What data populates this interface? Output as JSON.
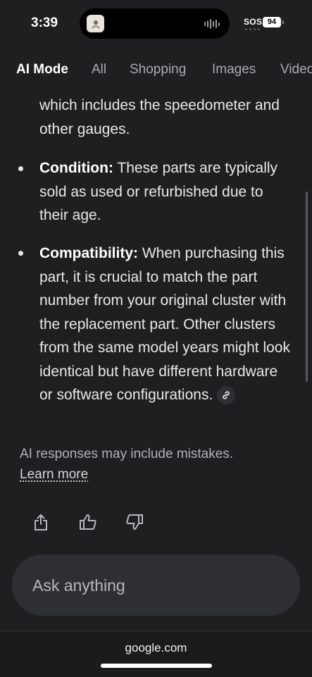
{
  "status_bar": {
    "time": "3:39",
    "carrier": "SOS",
    "battery": "94"
  },
  "tabs": [
    {
      "label": "AI Mode",
      "active": true
    },
    {
      "label": "All",
      "active": false
    },
    {
      "label": "Shopping",
      "active": false
    },
    {
      "label": "Images",
      "active": false
    },
    {
      "label": "Videos",
      "active": false
    }
  ],
  "content": {
    "partial_text": "which includes the speedometer and other gauges.",
    "bullets": [
      {
        "term": "Condition:",
        "text": " These parts are typically sold as used or refurbished due to their age."
      },
      {
        "term": "Compatibility:",
        "text": " When purchasing this part, it is crucial to match the part number from your original cluster with the replacement part. Other clusters from the same model years might look identical but have different hardware or software configurations."
      }
    ]
  },
  "disclaimer": {
    "text": "AI responses may include mistakes.",
    "link": "Learn more"
  },
  "icons": [
    "share-icon",
    "thumbs-up-icon",
    "thumbs-down-icon",
    "link-icon"
  ],
  "ask_box": {
    "placeholder": "Ask anything"
  },
  "browser": {
    "domain": "google.com"
  }
}
